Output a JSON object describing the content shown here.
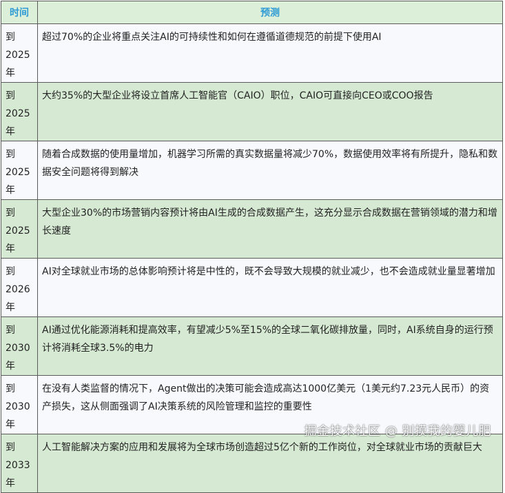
{
  "header": {
    "time": "时间",
    "prediction": "预测"
  },
  "rows": [
    {
      "time_lines": [
        "到",
        "2025",
        "年"
      ],
      "text": "超过70%的企业将重点关注AI的可持续性和如何在遵循道德规范的前提下使用AI"
    },
    {
      "time_lines": [
        "到",
        "2025",
        "年"
      ],
      "text": "大约35%的大型企业将设立首席人工智能官（CAIO）职位，CAIO可直接向CEO或COO报告"
    },
    {
      "time_lines": [
        "到",
        "2025",
        "年"
      ],
      "text": "随着合成数据的使用量增加，机器学习所需的真实数据量将减少70%，数据使用效率将有所提升，隐私和数据安全问题将得到解决"
    },
    {
      "time_lines": [
        "到",
        "2025",
        "年"
      ],
      "text": "大型企业30%的市场营销内容预计将由AI生成的合成数据产生，这充分显示合成数据在营销领域的潜力和增长速度"
    },
    {
      "time_lines": [
        "到",
        "2026",
        "年"
      ],
      "text": "AI对全球就业市场的总体影响预计将是中性的，既不会导致大规模的就业减少，也不会造成就业量显著增加"
    },
    {
      "time_lines": [
        "到",
        "2030",
        "年"
      ],
      "text": "AI通过优化能源消耗和提高效率，有望减少5%至15%的全球二氧化碳排放量，同时，AI系统自身的运行预计将消耗全球3.5%的电力"
    },
    {
      "time_lines": [
        "到",
        "2030",
        "年"
      ],
      "text": "在没有人类监督的情况下，Agent做出的决策可能会造成高达1000亿美元（1美元约7.23元人民币）的资产损失，这从侧面强调了AI决策系统的风险管理和监控的重要性"
    },
    {
      "time_lines": [
        "到",
        "2033",
        "年"
      ],
      "text": "人工智能解决方案的应用和发展将为全球市场创造超过5亿个新的工作岗位，对全球就业市场的贡献巨大"
    }
  ],
  "watermark": "掘金技术社区 @ 别摸我的婴儿肥",
  "colors": {
    "header_bg": "#dcefd9",
    "header_text": "#2f9bd5",
    "row_light": "#f7f9fc",
    "row_green": "#d6ead3",
    "border": "#5a5a5a"
  }
}
